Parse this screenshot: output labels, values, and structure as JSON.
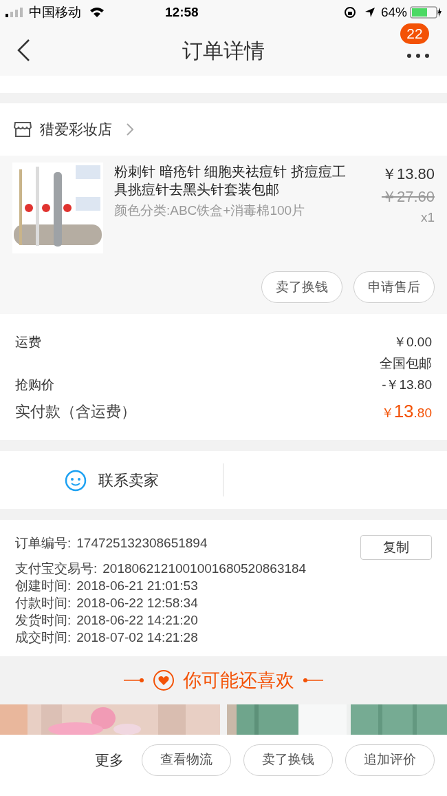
{
  "status_bar": {
    "carrier": "中国移动",
    "time": "12:58",
    "battery": "64%"
  },
  "nav": {
    "title": "订单详情",
    "badge": "22"
  },
  "shop": {
    "name": "猎爱彩妆店"
  },
  "item": {
    "title": "粉刺针 暗疮针 细胞夹祛痘针 挤痘痘工具挑痘针去黑头针套装包邮",
    "variant": "颜色分类:ABC铁盒+消毒棉100片",
    "price": "￥13.80",
    "original_price": "￥27.60",
    "quantity": "x1",
    "actions": [
      "卖了换钱",
      "申请售后"
    ]
  },
  "fees": [
    {
      "label": "运费",
      "value": "￥0.00",
      "note": "全国包邮"
    },
    {
      "label": "抢购价",
      "value": "-￥13.80"
    }
  ],
  "total": {
    "label": "实付款（含运费）",
    "currency": "￥",
    "integer": "13",
    "decimal": ".80"
  },
  "contact": {
    "label": "联系卖家"
  },
  "order_info": {
    "copy_button": "复制",
    "rows": [
      {
        "label": "订单编号:",
        "value": "174725132308651894"
      },
      {
        "label": "支付宝交易号:",
        "value": "2018062121001001680520863184"
      },
      {
        "label": "创建时间:",
        "value": "2018-06-21 21:01:53"
      },
      {
        "label": "付款时间:",
        "value": "2018-06-22 12:58:34"
      },
      {
        "label": "发货时间:",
        "value": "2018-06-22 14:21:20"
      },
      {
        "label": "成交时间:",
        "value": "2018-07-02 14:21:28"
      }
    ]
  },
  "recommend": {
    "title": "你可能还喜欢"
  },
  "bottom_bar": {
    "more": "更多",
    "buttons": [
      "查看物流",
      "卖了换钱",
      "追加评价"
    ]
  }
}
